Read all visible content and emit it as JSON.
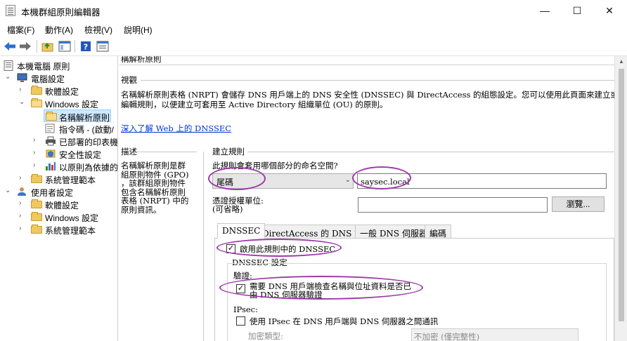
{
  "window": {
    "title": "本機群組原則編輯器",
    "minimize": "—",
    "maximize": "☐",
    "close": "✕"
  },
  "menu": [
    "檔案(F)",
    "動作(A)",
    "檢視(V)",
    "說明(H)"
  ],
  "toolbar": {
    "icons": [
      "back-icon",
      "forward-icon",
      "up-folder-icon",
      "show-hide-tree-icon",
      "help-icon",
      "properties-icon"
    ]
  },
  "tree": {
    "items": [
      {
        "label": "本機電腦 原則",
        "icon": "computer-policy-icon"
      },
      {
        "label": "電腦設定",
        "icon": "computer-icon"
      },
      {
        "label": "軟體設定",
        "icon": "folder-icon"
      },
      {
        "label": "Windows 設定",
        "icon": "folder-icon"
      },
      {
        "label": "名稱解析原則",
        "icon": "folder-icon"
      },
      {
        "label": "指令碼 - (啟動/",
        "icon": "script-icon"
      },
      {
        "label": "已部署的印表機",
        "icon": "printer-icon"
      },
      {
        "label": "安全性設定",
        "icon": "security-icon"
      },
      {
        "label": "以原則為依據的",
        "icon": "qos-chart-icon"
      },
      {
        "label": "系統管理範本",
        "icon": "folder-icon"
      },
      {
        "label": "使用者設定",
        "icon": "user-icon"
      },
      {
        "label": "軟體設定",
        "icon": "folder-icon"
      },
      {
        "label": "Windows 設定",
        "icon": "folder-icon"
      },
      {
        "label": "系統管理範本",
        "icon": "folder-icon"
      }
    ]
  },
  "content": {
    "header_partial": "稱解析原則",
    "overview_label": "視觀",
    "overview_line1": "名稱解析原則表格 (NRPT) 會儲存 DNS 用戶端上的 DNS 安全性 (DNSSEC) 與 DirectAccess 的組態設定。您可以使用此頁面來建立或",
    "overview_line2": "編輯規則，以便建立可套用至 Active Directory 組織單位 (OU) 的原則。",
    "learn_link": "深入了解 Web 上的 DNSSEC",
    "description_label": "描述",
    "description_lines": [
      "名稱解析原則是群",
      "組原則物件 (GPO)",
      "，該群組原則物件",
      "包含名稱解析原則",
      "表格 (NRPT) 中的",
      "原則資訊。"
    ],
    "create_rules_label": "建立規則",
    "namespace_question": "此規則會套用哪個部分的命名空間?",
    "namespace_type": "尾碼",
    "namespace_value": "saysec.local",
    "cert_authority_label": "憑證授權單位:",
    "cert_authority_optional": "(可省略)",
    "cert_authority_value": "",
    "browse_button": "瀏覽...",
    "tabs": [
      "DNSSEC",
      "DirectAccess 的 DNS 設定",
      "一般 DNS 伺服器",
      "編碼"
    ],
    "enable_dnssec_label": "啟用此規則中的 DNSSEC",
    "enable_dnssec_checked": true,
    "dnssec_settings_label": "DNSSEC 設定",
    "validation_label": "驗證:",
    "require_validation_line1": "需要 DNS 用戶端檢查名稱與位址資料是否已",
    "require_validation_line2": "由 DNS 伺服器驗證",
    "require_validation_checked": true,
    "ipsec_label": "IPsec:",
    "use_ipsec_label": "使用 IPsec 在 DNS 用戶端與 DNS 伺服器之間通訊",
    "use_ipsec_checked": false,
    "encryption_type_label": "加密類型:",
    "encryption_type_value": "不加密 (僅完整性)"
  },
  "colors": {
    "annotation": "#9c3aa8",
    "link": "#0033cc",
    "selection": "#cce8ff"
  }
}
